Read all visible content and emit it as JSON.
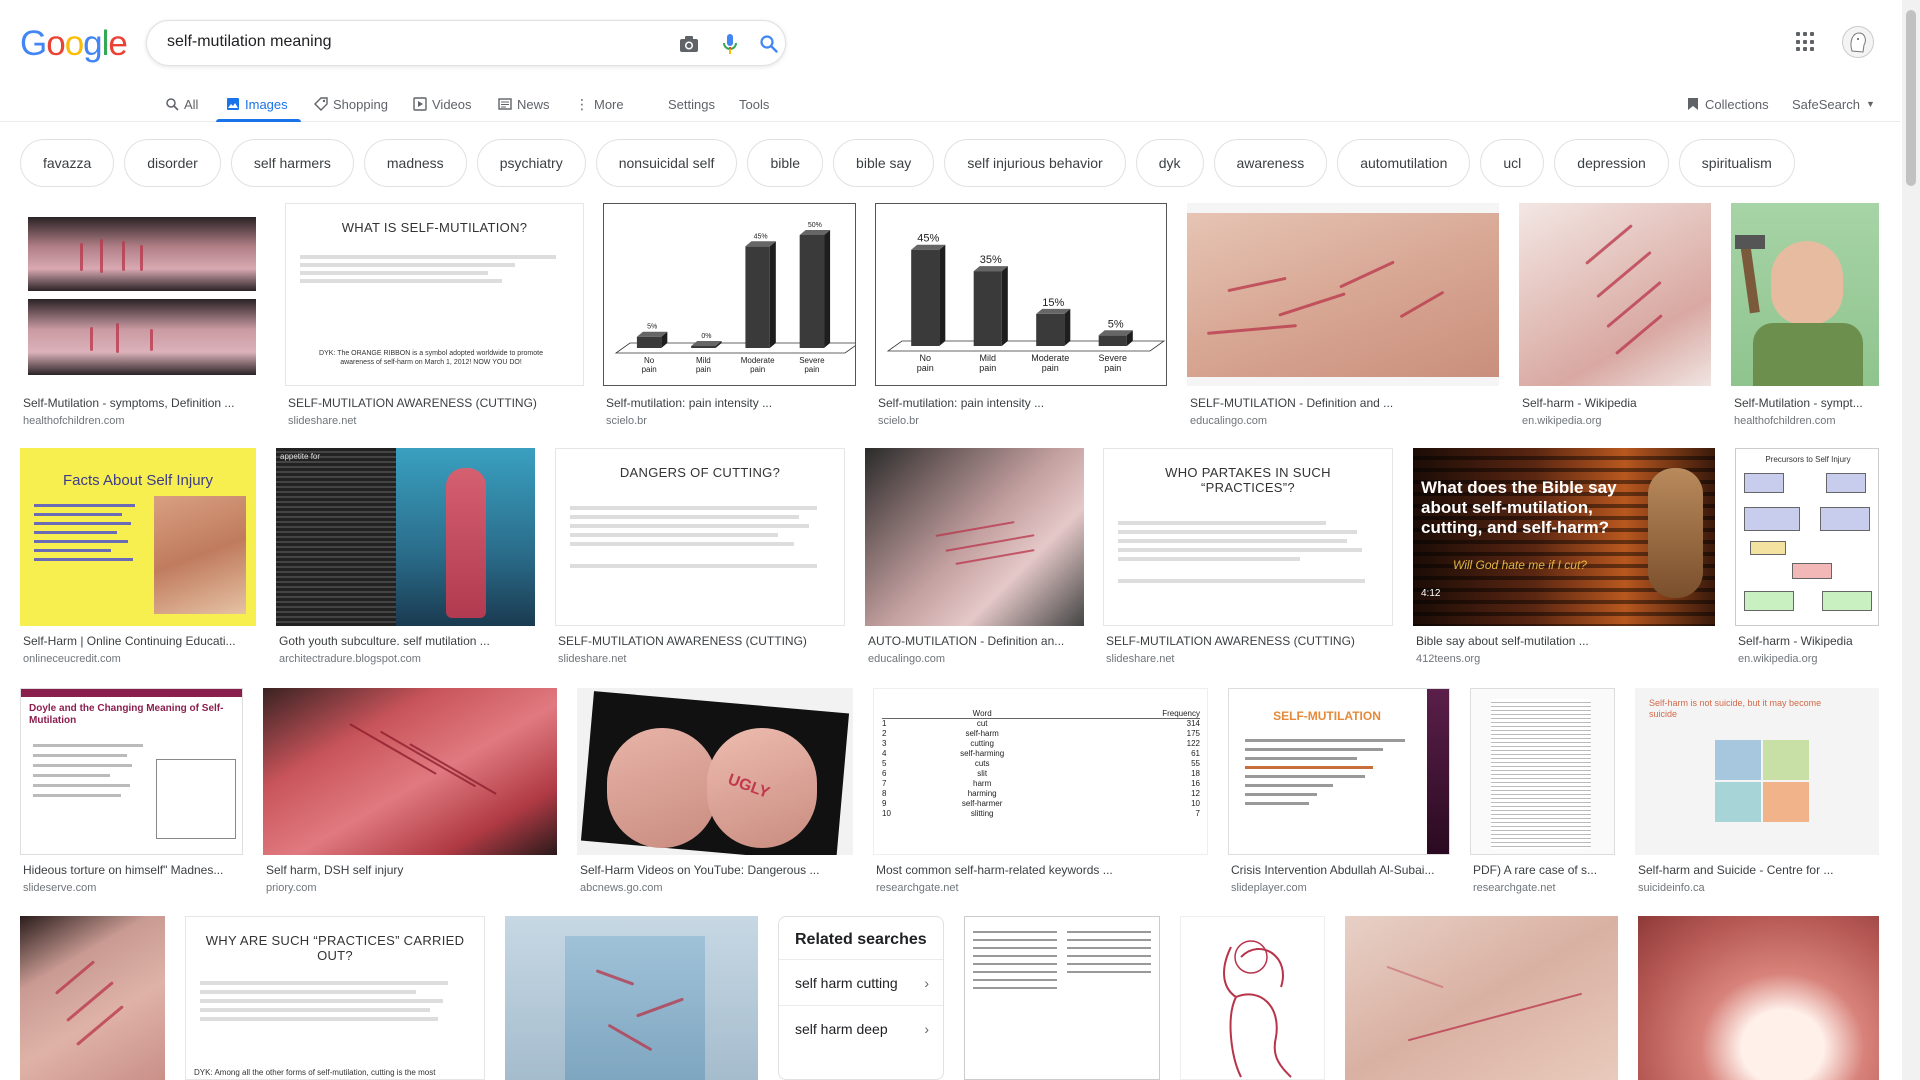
{
  "search": {
    "query": "self-mutilation meaning"
  },
  "tabs": [
    {
      "label": "All",
      "icon": "search-icon"
    },
    {
      "label": "Images",
      "icon": "image-icon"
    },
    {
      "label": "Shopping",
      "icon": "tag-icon"
    },
    {
      "label": "Videos",
      "icon": "play-icon"
    },
    {
      "label": "News",
      "icon": "newspaper-icon"
    },
    {
      "label": "More",
      "icon": "dots-vertical-icon"
    }
  ],
  "tools": {
    "settings": "Settings",
    "tools": "Tools",
    "collections": "Collections",
    "safesearch": "SafeSearch"
  },
  "chips": [
    "favazza",
    "disorder",
    "self harmers",
    "madness",
    "psychiatry",
    "nonsuicidal self",
    "bible",
    "bible say",
    "self injurious behavior",
    "dyk",
    "awareness",
    "automutilation",
    "ucl",
    "depression",
    "spiritualism"
  ],
  "results": [
    {
      "title": "Self-Mutilation - symptoms, Definition ...",
      "source": "healthofchildren.com"
    },
    {
      "title": "SELF-MUTILATION AWARENESS (CUTTING)",
      "source": "slideshare.net",
      "slide_title": "WHAT IS SELF-MUTILATION?"
    },
    {
      "title": "Self-mutilation: pain intensity ...",
      "source": "scielo.br"
    },
    {
      "title": "Self-mutilation: pain intensity ...",
      "source": "scielo.br"
    },
    {
      "title": "SELF-MUTILATION - Definition and ...",
      "source": "educalingo.com"
    },
    {
      "title": "Self-harm - Wikipedia",
      "source": "en.wikipedia.org"
    },
    {
      "title": "Self-Mutilation - sympt...",
      "source": "healthofchildren.com"
    },
    {
      "title": "Self-Harm | Online Continuing Educati...",
      "source": "onlineceucredit.com",
      "slide_title": "Facts About Self Injury"
    },
    {
      "title": "Goth youth subculture. self mutilation ...",
      "source": "architectradure.blogspot.com",
      "slide_title": "appetite for"
    },
    {
      "title": "SELF-MUTILATION AWARENESS (CUTTING)",
      "source": "slideshare.net",
      "slide_title": "DANGERS OF CUTTING?"
    },
    {
      "title": "AUTO-MUTILATION - Definition an...",
      "source": "educalingo.com"
    },
    {
      "title": "SELF-MUTILATION AWARENESS (CUTTING)",
      "source": "slideshare.net",
      "slide_title": "WHO PARTAKES IN SUCH “PRACTICES”?"
    },
    {
      "title": "Bible say about self-mutilation ...",
      "source": "412teens.org",
      "slide_title": "What does the Bible say about self-mutilation, cutting, and self-harm?"
    },
    {
      "title": "Self-harm - Wikipedia",
      "source": "en.wikipedia.org",
      "slide_title": "Precursors to Self Injury"
    },
    {
      "title": "Hideous torture on himself\" Madnes...",
      "source": "slideserve.com",
      "slide_title": "Doyle and the Changing Meaning of Self-Mutilation"
    },
    {
      "title": "Self harm, DSH self injury",
      "source": "priory.com"
    },
    {
      "title": "Self-Harm Videos on YouTube: Dangerous ...",
      "source": "abcnews.go.com"
    },
    {
      "title": "Most common self-harm-related keywords ...",
      "source": "researchgate.net"
    },
    {
      "title": "Crisis Intervention Abdullah Al-Subai...",
      "source": "slideplayer.com",
      "slide_title": "SELF-MUTILATION"
    },
    {
      "title": "PDF) A rare case of s...",
      "source": "researchgate.net"
    },
    {
      "title": "Self-harm and Suicide - Centre for ...",
      "source": "suicideinfo.ca",
      "slide_title": "Self-harm is not suicide, but it may become suicide"
    }
  ],
  "chart_a": {
    "labels": [
      "No pain",
      "Mild pain",
      "Moderate pain",
      "Severe pain"
    ],
    "values": [
      5,
      0,
      45,
      50
    ],
    "value_labels": [
      "5%",
      "0%",
      "45%",
      "50%"
    ]
  },
  "chart_b": {
    "labels": [
      "No pain",
      "Mild pain",
      "Moderate pain",
      "Severe pain"
    ],
    "values": [
      45,
      35,
      15,
      5
    ],
    "value_labels": [
      "45%",
      "35%",
      "15%",
      "5%"
    ]
  },
  "keywords_table": {
    "headers": [
      "Word",
      "Frequency"
    ],
    "rows": [
      [
        "1",
        "cut",
        "314"
      ],
      [
        "2",
        "self-harm",
        "175"
      ],
      [
        "3",
        "cutting",
        "122"
      ],
      [
        "4",
        "self-harming",
        "61"
      ],
      [
        "5",
        "cuts",
        "55"
      ],
      [
        "6",
        "slit",
        "18"
      ],
      [
        "7",
        "harm",
        "16"
      ],
      [
        "8",
        "harming",
        "12"
      ],
      [
        "9",
        "self-harmer",
        "10"
      ],
      [
        "10",
        "slitting",
        "7"
      ]
    ]
  },
  "bottom_row": {
    "slide_title": "WHY ARE SUCH “PRACTICES” CARRIED OUT?",
    "slide_footer": "DYK: Among all the other forms of self-mutilation, cutting is the most"
  },
  "related_searches": {
    "heading": "Related searches",
    "items": [
      "self harm cutting",
      "self harm deep"
    ]
  },
  "dyk_text": "DYK: The ORANGE RIBBON is a symbol adopted worldwide to promote awareness of self-harm on March 1, 2012! NOW YOU DO!",
  "video_time": "4:12",
  "bible_subtitle": "Will God hate me if I cut?"
}
